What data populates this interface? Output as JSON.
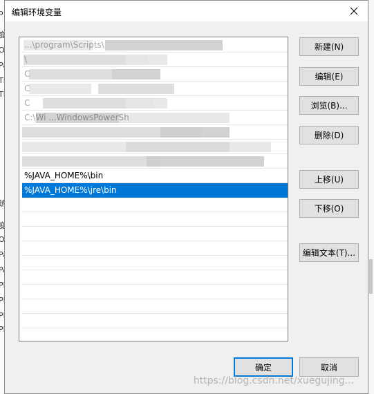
{
  "dialog": {
    "title": "编辑环境变量",
    "close_glyph": "✕"
  },
  "background": {
    "left_fragments": [
      "o",
      "变",
      "O",
      "Pa",
      "TE",
      "TN",
      "统",
      "变",
      "O",
      "Pa",
      "PA",
      "PF",
      "PF",
      "PF",
      "PF"
    ]
  },
  "list": {
    "items": [
      {
        "text": "...\\program\\Scripts\\",
        "blurred": true,
        "selected": false
      },
      {
        "text": "\\",
        "blurred": true,
        "selected": false
      },
      {
        "text": "C",
        "blurred": true,
        "selected": false
      },
      {
        "text": "C",
        "blurred": true,
        "selected": false
      },
      {
        "text": "C",
        "blurred": true,
        "selected": false
      },
      {
        "text": "C:\\Wi ...WindowsPowerSh",
        "blurred": true,
        "selected": false
      },
      {
        "text": "",
        "blurred": true,
        "selected": false
      },
      {
        "text": "",
        "blurred": true,
        "selected": false
      },
      {
        "text": "",
        "blurred": true,
        "selected": false
      },
      {
        "text": "%JAVA_HOME%\\bin",
        "blurred": false,
        "selected": false
      },
      {
        "text": "%JAVA_HOME%\\jre\\bin",
        "blurred": false,
        "selected": true
      },
      {
        "text": "",
        "blurred": false,
        "selected": false
      },
      {
        "text": "",
        "blurred": false,
        "selected": false
      },
      {
        "text": "",
        "blurred": false,
        "selected": false
      },
      {
        "text": "",
        "blurred": false,
        "selected": false
      },
      {
        "text": "",
        "blurred": false,
        "selected": false
      },
      {
        "text": "",
        "blurred": false,
        "selected": false
      },
      {
        "text": "",
        "blurred": false,
        "selected": false
      },
      {
        "text": "",
        "blurred": false,
        "selected": false
      },
      {
        "text": "",
        "blurred": false,
        "selected": false
      }
    ]
  },
  "buttons": {
    "new": "新建(N)",
    "edit": "编辑(E)",
    "browse": "浏览(B)...",
    "delete": "删除(D)",
    "move_up": "上移(U)",
    "move_down": "下移(O)",
    "edit_text": "编辑文本(T)...",
    "ok": "确定",
    "cancel": "取消"
  },
  "watermark": "https://blog.csdn.net/xuegujing...",
  "colors": {
    "selection": "#0078d7",
    "primary_border": "#0078d7",
    "button_bg": "#e1e1e1"
  }
}
